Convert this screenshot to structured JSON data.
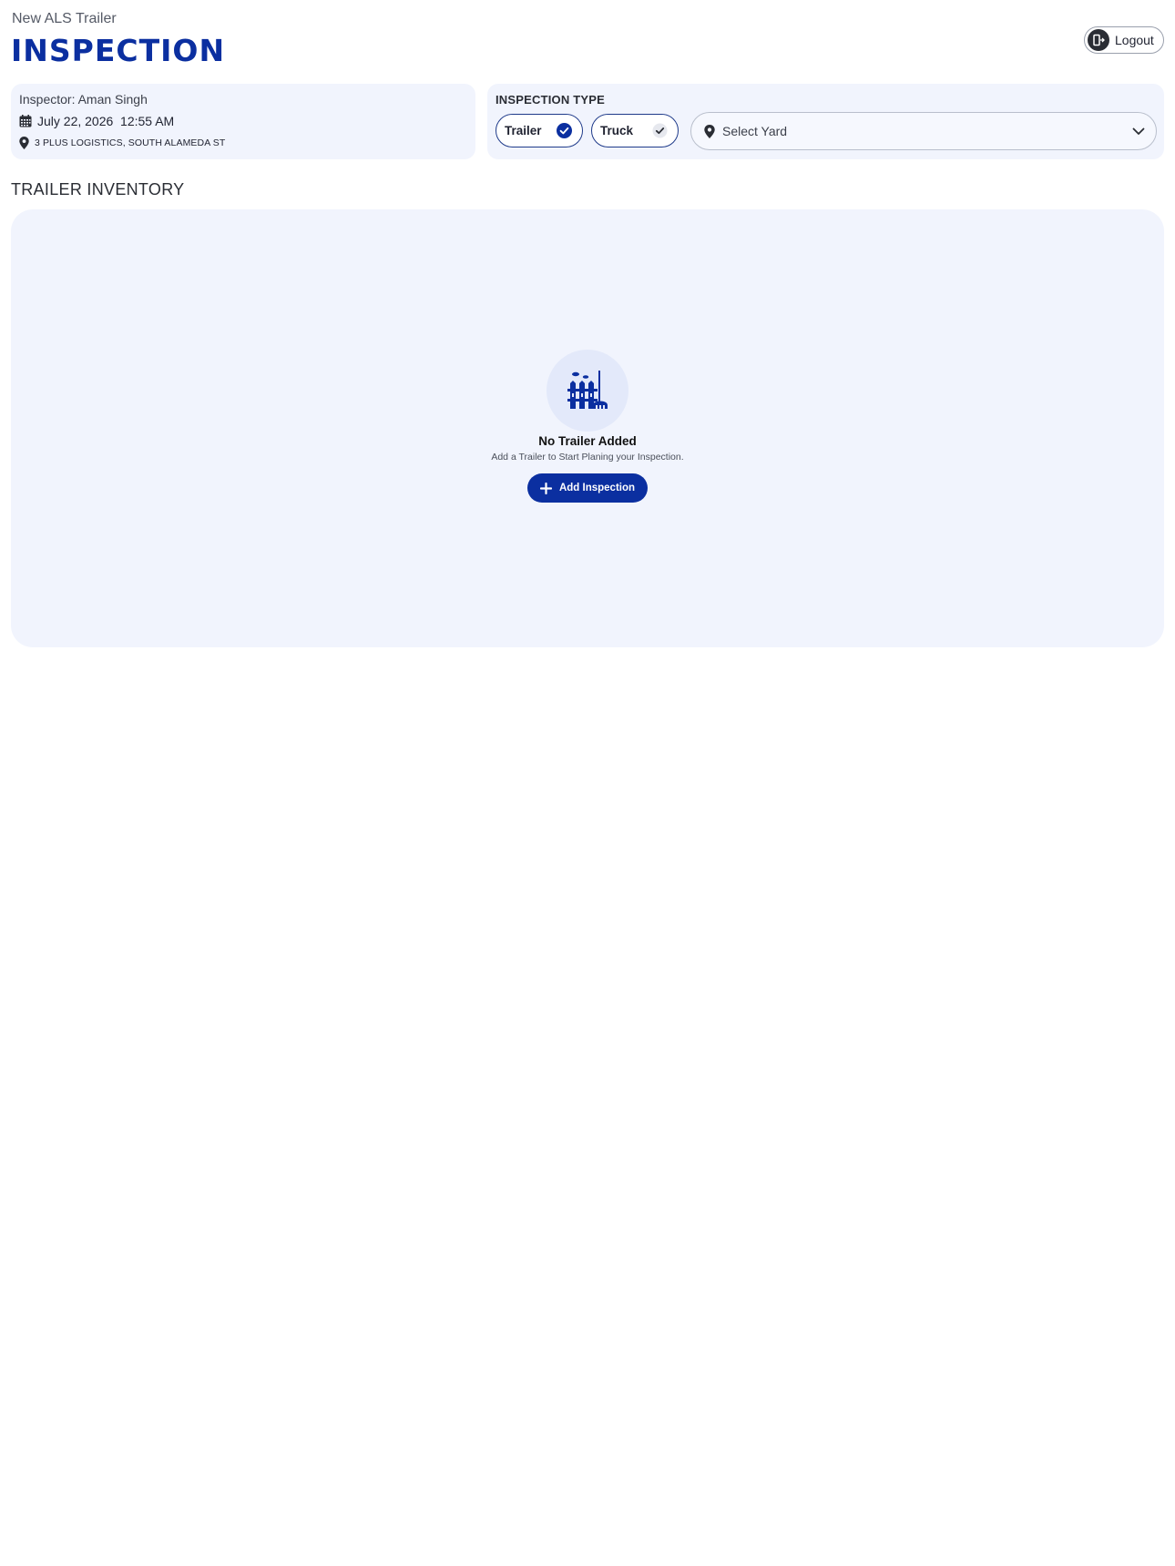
{
  "header": {
    "subtitle": "New ALS Trailer",
    "title": "INSPECTION",
    "logout_label": "Logout"
  },
  "info": {
    "inspector": "Inspector: Aman Singh",
    "datetime": "July 22, 2026  12:55 AM",
    "address": "3 PLUS LOGISTICS, SOUTH ALAMEDA ST"
  },
  "inspection_type": {
    "label": "INSPECTION TYPE",
    "options": [
      {
        "label": "Trailer",
        "selected": true
      },
      {
        "label": "Truck",
        "selected": false
      }
    ],
    "yard_placeholder": "Select Yard"
  },
  "inventory": {
    "title": "TRAILER INVENTORY",
    "empty_title": "No Trailer Added",
    "empty_subtitle": "Add a Trailer to Start Planing your Inspection.",
    "add_button": "Add Inspection"
  },
  "colors": {
    "brand": "#0b2fa0",
    "card_bg": "#f1f4fd",
    "illustration_bg": "#e3e9fa"
  },
  "icons": [
    "logout-icon",
    "calendar-icon",
    "location-pin-icon",
    "check-circle-icon",
    "chevron-down-icon",
    "plus-icon",
    "yard-fence-icon"
  ]
}
